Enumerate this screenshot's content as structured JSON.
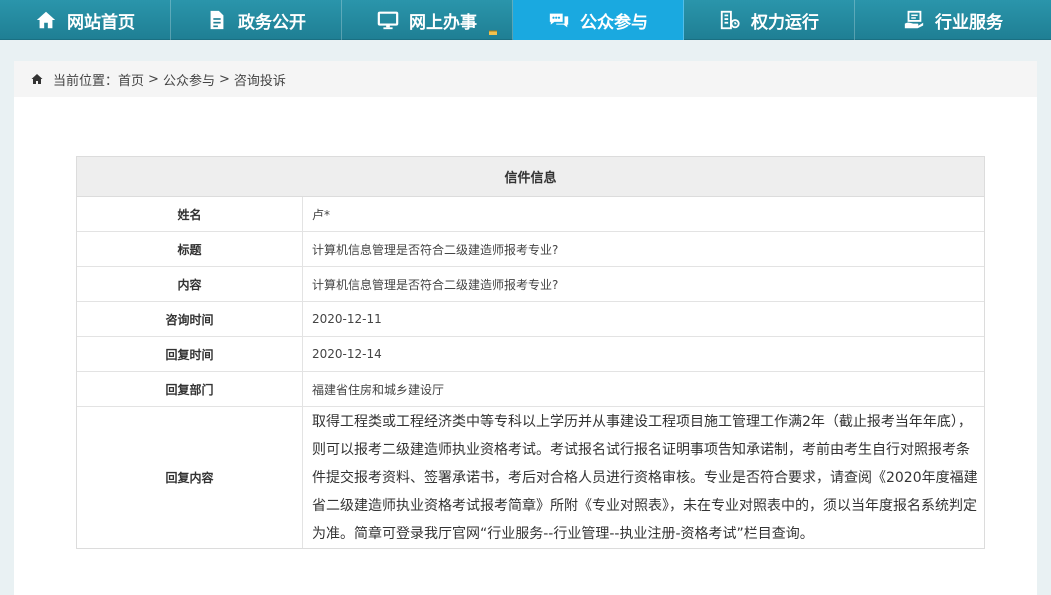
{
  "nav": {
    "items": [
      {
        "label": "网站首页",
        "icon": "home-icon"
      },
      {
        "label": "政务公开",
        "icon": "document-icon"
      },
      {
        "label": "网上办事",
        "icon": "monitor-icon"
      },
      {
        "label": "公众参与",
        "icon": "chat-icon",
        "active": true
      },
      {
        "label": "权力运行",
        "icon": "building-icon"
      },
      {
        "label": "行业服务",
        "icon": "service-icon"
      }
    ],
    "active_color": "#1aa9e0",
    "bar_color": "#2a95ab"
  },
  "breadcrumb": {
    "prefix": "当前位置：",
    "items": [
      "首页",
      "公众参与",
      "咨询投诉"
    ],
    "separator": ">"
  },
  "letter": {
    "title": "信件信息",
    "rows": [
      {
        "label": "姓名",
        "value": "卢*"
      },
      {
        "label": "标题",
        "value": "计算机信息管理是否符合二级建造师报考专业?"
      },
      {
        "label": "内容",
        "value": "计算机信息管理是否符合二级建造师报考专业?"
      },
      {
        "label": "咨询时间",
        "value": "2020-12-11"
      },
      {
        "label": "回复时间",
        "value": "2020-12-14"
      },
      {
        "label": "回复部门",
        "value": "福建省住房和城乡建设厅"
      },
      {
        "label": "回复内容",
        "value": "取得工程类或工程经济类中等专科以上学历并从事建设工程项目施工管理工作满2年（截止报考当年年底），则可以报考二级建造师执业资格考试。考试报名试行报名证明事项告知承诺制，考前由考生自行对照报考条件提交报考资料、签署承诺书，考后对合格人员进行资格审核。专业是否符合要求，请查阅《2020年度福建省二级建造师执业资格考试报考简章》所附《专业对照表》，未在专业对照表中的，须以当年度报名系统判定为准。简章可登录我厅官网“行业服务--行业管理--执业注册-资格考试”栏目查询。"
      }
    ]
  }
}
